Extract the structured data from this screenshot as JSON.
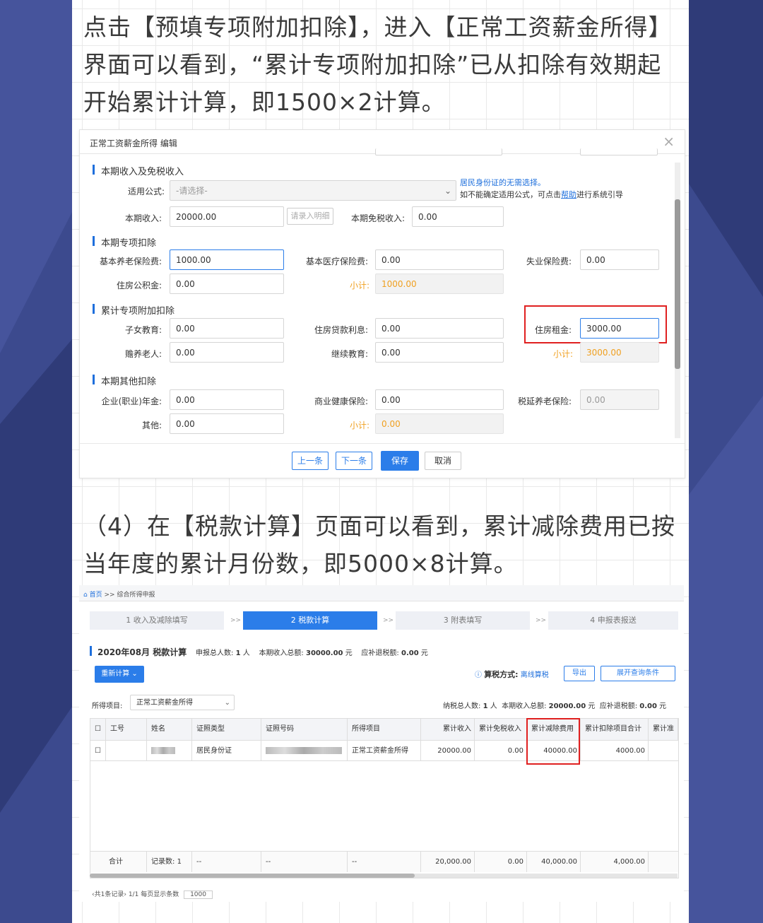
{
  "caption1": "点击【预填专项附加扣除】，进入【正常工资薪金所得】界面可以看到，“累计专项附加扣除”已从扣除有效期起开始累计计算，即1500×2计算。",
  "caption2": "（4）在【税款计算】页面可以看到，累计减除费用已按当年度的累计月份数，即5000×8计算。",
  "dialog": {
    "title": "正常工资薪金所得 编辑",
    "close": "×",
    "sections": {
      "income": "本期收入及免税收入",
      "special": "本期专项扣除",
      "cumulative": "累计专项附加扣除",
      "other": "本期其他扣除"
    },
    "formula_label": "适用公式:",
    "formula_value": "-请选择-",
    "helper_line1": "居民身份证的无需选择。",
    "helper_line2a": "如不能确定适用公式，可点击",
    "helper_link": "帮助",
    "helper_line2b": "进行系统引导",
    "income_label": "本期收入:",
    "income_value": "20000.00",
    "detail_button": "请录入明细",
    "taxfree_label": "本期免税收入:",
    "taxfree_value": "0.00",
    "pension_label": "基本养老保险费:",
    "pension_value": "1000.00",
    "medical_label": "基本医疗保险费:",
    "medical_value": "0.00",
    "unemp_label": "失业保险费:",
    "unemp_value": "0.00",
    "housing_fund_label": "住房公积金:",
    "housing_fund_value": "0.00",
    "subtotal_label": "小计:",
    "special_subtotal": "1000.00",
    "child_label": "子女教育:",
    "child_value": "0.00",
    "loan_label": "住房贷款利息:",
    "loan_value": "0.00",
    "rent_label": "住房租金:",
    "rent_value": "3000.00",
    "elder_label": "赡养老人:",
    "elder_value": "0.00",
    "cont_edu_label": "继续教育:",
    "cont_edu_value": "0.00",
    "cumulative_subtotal": "3000.00",
    "annuity_label": "企业(职业)年金:",
    "annuity_value": "0.00",
    "health_label": "商业健康保险:",
    "health_value": "0.00",
    "tax_pension_label": "税延养老保险:",
    "tax_pension_value": "0.00",
    "other_label": "其他:",
    "other_value": "0.00",
    "other_subtotal": "0.00",
    "buttons": {
      "prev": "上一条",
      "next": "下一条",
      "save": "保存",
      "cancel": "取消"
    }
  },
  "screen2": {
    "breadcrumb_home": "首页",
    "breadcrumb_sep": ">>",
    "breadcrumb_page": "综合所得申报",
    "steps": [
      "1 收入及减除填写",
      "2 税款计算",
      "3 附表填写",
      "4 申报表报送"
    ],
    "step_arrow": ">>",
    "period_title": "2020年08月  税款计算",
    "declare_count_label": "申报总人数:",
    "declare_count": "1",
    "person_unit": "人",
    "income_total_label": "本期收入总额:",
    "income_total": "30000.00",
    "yuan": "元",
    "refund_label": "应补退税额:",
    "refund": "0.00",
    "recalc_button": "重新计算",
    "method_label": "算税方式:",
    "method_value": "离线算税",
    "export_button": "导出",
    "expand_button": "展开查询条件",
    "item_label": "所得项目:",
    "item_value": "正常工资薪金所得",
    "taxpayer_count_label": "纳税总人数:",
    "taxpayer_count": "1",
    "income_total2_label": "本期收入总额:",
    "income_total2": "20000.00",
    "refund2_label": "应补退税额:",
    "refund2": "0.00",
    "headers": [
      "工号",
      "姓名",
      "证照类型",
      "证照号码",
      "所得项目",
      "累计收入",
      "累计免税收入",
      "累计减除费用",
      "累计扣除项目合计",
      "累计准"
    ],
    "row": {
      "id_type": "居民身份证",
      "item": "正常工资薪金所得",
      "income": "20000.00",
      "taxfree": "0.00",
      "deduct": "40000.00",
      "items_total": "4000.00"
    },
    "footer": {
      "sum": "合计",
      "records_label": "记录数:",
      "records": "1",
      "dash": "--",
      "income": "20,000.00",
      "taxfree": "0.00",
      "deduct": "40,000.00",
      "items_total": "4,000.00"
    },
    "pager": {
      "total": "共1条记录",
      "page": "1/1",
      "per_page_label": "每页显示条数",
      "per_page": "1000"
    }
  }
}
